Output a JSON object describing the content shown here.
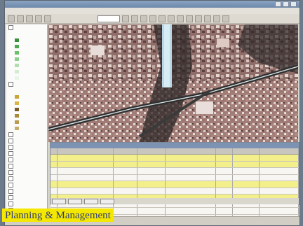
{
  "caption": "Planning & Management",
  "colors": {
    "caption_bg": "#f4e800",
    "caption_text": "#2e3a78",
    "highlight_row": "#f3f08b",
    "map_base": "#9e7b74",
    "road": "#2f2f2f",
    "canal": "#b8d8e8"
  },
  "table": {
    "rows": 10,
    "highlighted_rows": [
      0,
      1,
      4,
      6
    ]
  },
  "icons": [
    "window-minimize-icon",
    "window-maximize-icon",
    "window-close-icon",
    "toolbar-button-icon",
    "layer-checkbox-icon"
  ]
}
